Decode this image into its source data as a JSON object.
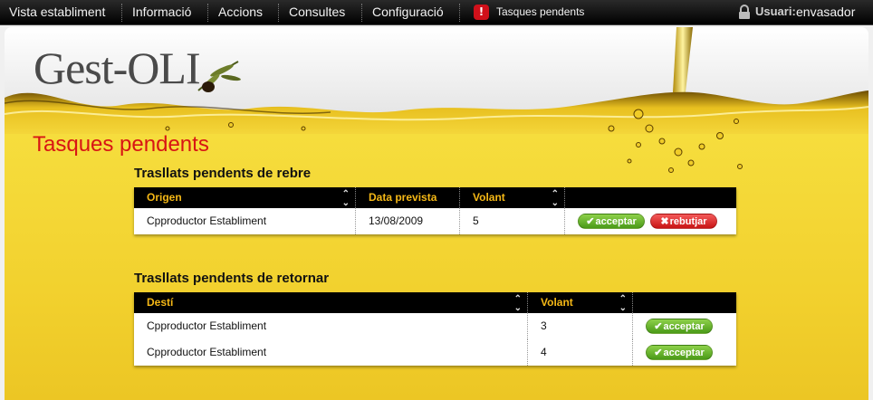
{
  "nav": {
    "items": [
      "Vista establiment",
      "Informació",
      "Accions",
      "Consultes",
      "Configuració"
    ],
    "tasks_label": "Tasques pendents",
    "user_label": "Usuari:",
    "user_name": "envasador"
  },
  "logo": {
    "text": "Gest-OLI"
  },
  "page": {
    "title": "Tasques pendents"
  },
  "receive": {
    "title": "Trasllats pendents de rebre",
    "columns": [
      "Origen",
      "Data prevista",
      "Volant",
      ""
    ],
    "rows": [
      {
        "origen": "Cpproductor Establiment",
        "data": "13/08/2009",
        "volant": "5",
        "accept": "acceptar",
        "reject": "rebutjar"
      }
    ]
  },
  "return": {
    "title": "Trasllats pendents de retornar",
    "columns": [
      "Destí",
      "Volant",
      ""
    ],
    "rows": [
      {
        "desti": "Cpproductor Establiment",
        "volant": "3",
        "accept": "acceptar"
      },
      {
        "desti": "Cpproductor Establiment",
        "volant": "4",
        "accept": "acceptar"
      }
    ]
  },
  "colors": {
    "accent_red": "#d81414",
    "header_gold": "#f5b816",
    "oil_yellow": "#f2d12e",
    "btn_green": "#5aa81f",
    "btn_red": "#d81e1e"
  }
}
